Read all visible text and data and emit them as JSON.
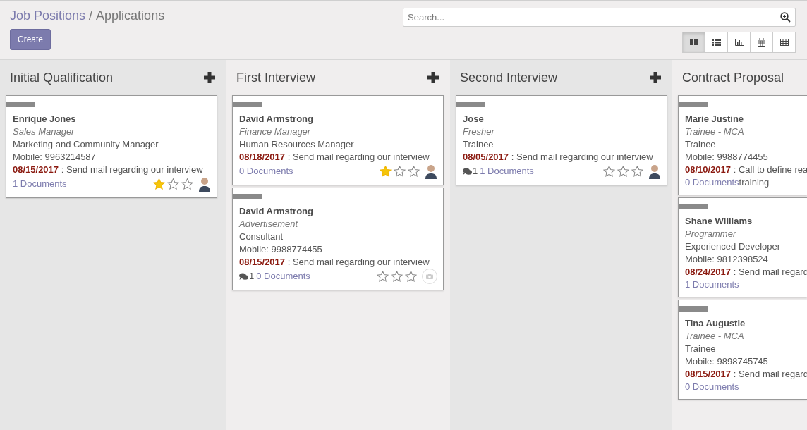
{
  "breadcrumb": {
    "parent": "Job Positions",
    "separator": "/",
    "current": "Applications"
  },
  "create_button": "Create",
  "search": {
    "placeholder": "Search..."
  },
  "view_switcher": [
    {
      "kind": "kanban",
      "selected": true
    },
    {
      "kind": "list",
      "selected": false
    },
    {
      "kind": "graph",
      "selected": false
    },
    {
      "kind": "calendar",
      "selected": false
    },
    {
      "kind": "pivot",
      "selected": false
    }
  ],
  "columns": [
    {
      "title": "Initial Qualification",
      "add": true,
      "cards": [
        {
          "name": "Enrique Jones",
          "source": "Sales Manager",
          "job": "Marketing and Community Manager",
          "mobile": "Mobile: 9963214587",
          "date": "08/15/2017",
          "activity": " : Send mail regarding our interview",
          "documents": "1 Documents",
          "stars": 1,
          "avatar": {
            "kind": "photo"
          }
        }
      ]
    },
    {
      "title": "First Interview",
      "add": true,
      "cards": [
        {
          "name": "David Armstrong",
          "source": "Finance Manager",
          "job": "Human Resources Manager",
          "date": "08/18/2017",
          "activity": " : Send mail regarding our interview",
          "documents": "0 Documents",
          "stars": 1,
          "avatar": {
            "kind": "photo"
          }
        },
        {
          "name": "David Armstrong",
          "source": "Advertisement",
          "job": "Consultant",
          "mobile": "Mobile: 9988774455",
          "date": "08/15/2017",
          "activity": " : Send mail regarding our interview",
          "messages": "1",
          "documents": "0 Documents",
          "stars": 0,
          "avatar": {
            "kind": "placeholder"
          }
        }
      ]
    },
    {
      "title": "Second Interview",
      "add": true,
      "cards": [
        {
          "name": "Jose",
          "source": "Fresher",
          "job": "Trainee",
          "date": "08/05/2017",
          "activity": " : Send mail regarding our interview",
          "messages": "1",
          "documents": "1 Documents",
          "stars": 0,
          "avatar": {
            "kind": "photo"
          }
        }
      ]
    },
    {
      "title": "Contract Proposal",
      "add": false,
      "cards": [
        {
          "name": "Marie Justine",
          "source": "Trainee - MCA",
          "job": "Trainee",
          "mobile": "Mobile: 9988774455",
          "date": "08/10/2017",
          "activity": " : Call to define rea",
          "documents": "0 Documents",
          "activity_overflow": "training"
        },
        {
          "name": "Shane Williams",
          "source": "Programmer",
          "job": "Experienced Developer",
          "mobile": "Mobile: 9812398524",
          "date": "08/24/2017",
          "activity": " : Send mail regard",
          "documents": "1 Documents"
        },
        {
          "name": "Tina Augustie",
          "source": "Trainee - MCA",
          "job": "Trainee",
          "mobile": "Mobile: 9898745745",
          "date": "08/15/2017",
          "activity": " : Send mail regard",
          "documents": "0 Documents"
        }
      ]
    }
  ]
}
